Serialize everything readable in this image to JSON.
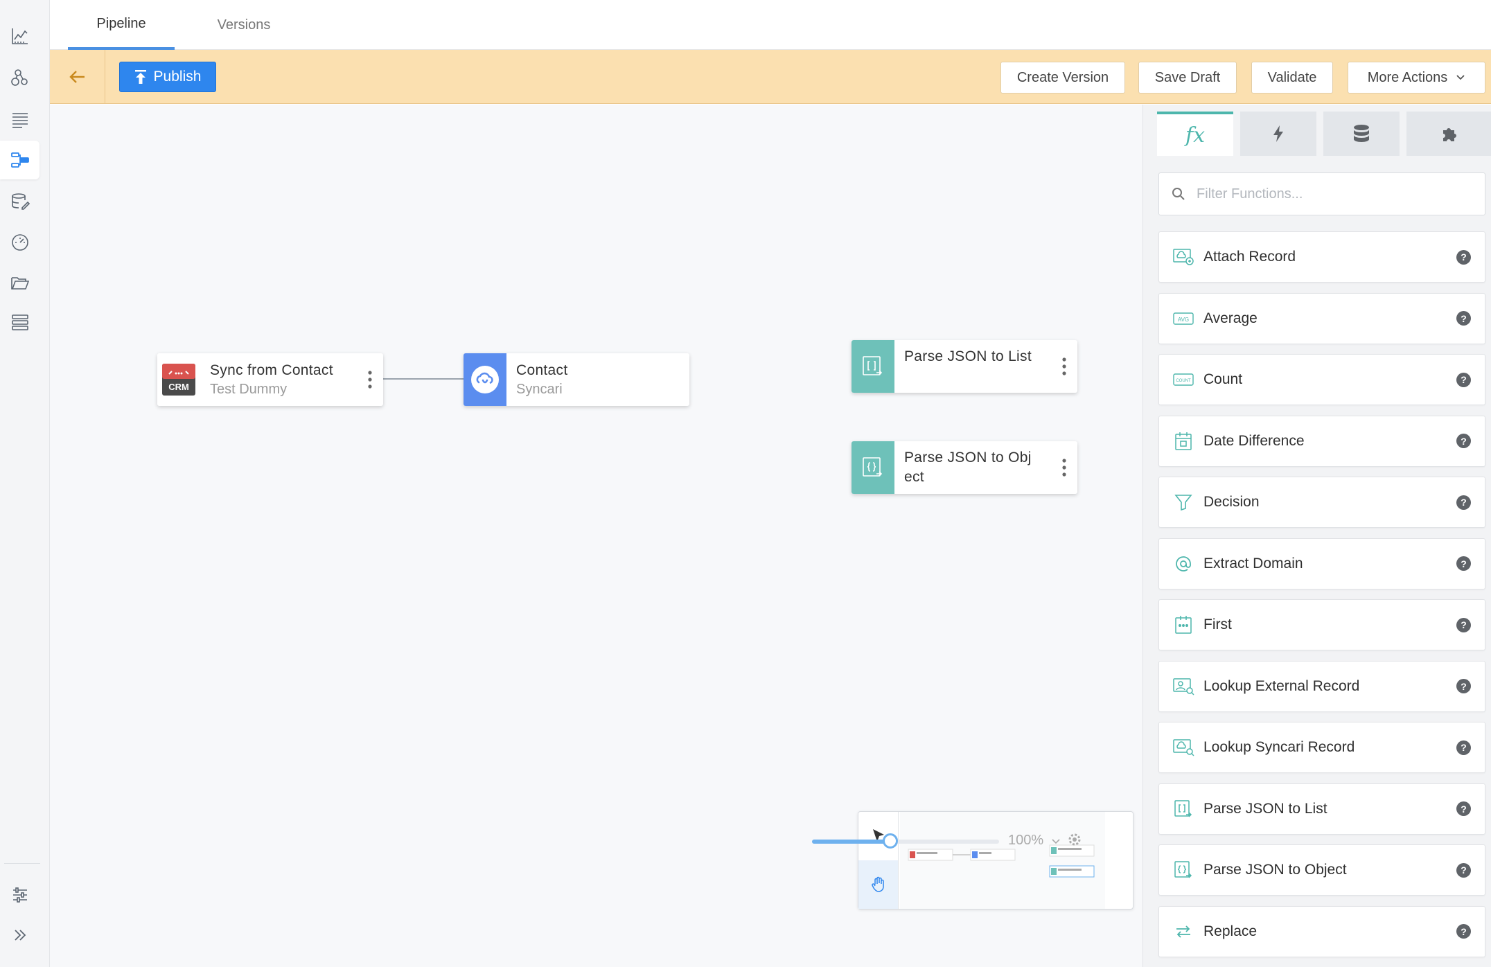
{
  "tabs": {
    "pipeline": "Pipeline",
    "versions": "Versions"
  },
  "toolbar": {
    "publish": "Publish",
    "create_version": "Create Version",
    "save_draft": "Save Draft",
    "validate": "Validate",
    "more_actions": "More Actions"
  },
  "canvas": {
    "nodes": {
      "sync": {
        "title": "Sync from Contact",
        "subtitle": "Test Dummy",
        "badge": "CRM"
      },
      "contact": {
        "title": "Contact",
        "subtitle": "Syncari"
      },
      "parse_list": {
        "title": "Parse JSON to List"
      },
      "parse_object": {
        "title_line1": "Parse JSON to Obj",
        "title_line2": "ect"
      }
    },
    "zoom": "100%"
  },
  "panel": {
    "filter_placeholder": "Filter Functions...",
    "tab_fx_label": "fx",
    "functions": [
      {
        "label": "Attach Record",
        "icon": "attach-record-icon"
      },
      {
        "label": "Average",
        "icon": "avg-icon"
      },
      {
        "label": "Count",
        "icon": "count-icon"
      },
      {
        "label": "Date Difference",
        "icon": "calendar-icon"
      },
      {
        "label": "Decision",
        "icon": "funnel-icon"
      },
      {
        "label": "Extract Domain",
        "icon": "at-sign-icon"
      },
      {
        "label": "First",
        "icon": "first-icon"
      },
      {
        "label": "Lookup External Record",
        "icon": "lookup-external-icon"
      },
      {
        "label": "Lookup Syncari Record",
        "icon": "lookup-syncari-icon"
      },
      {
        "label": "Parse JSON to List",
        "icon": "json-list-icon"
      },
      {
        "label": "Parse JSON to Object",
        "icon": "json-object-icon"
      },
      {
        "label": "Replace",
        "icon": "swap-arrows-icon"
      }
    ]
  },
  "colors": {
    "accent": "#2e86ee",
    "toolbar_bg": "#fbe0b0",
    "teal": "#4db6ac",
    "node_blue": "#5b8def",
    "crm_red": "#d9534f"
  }
}
